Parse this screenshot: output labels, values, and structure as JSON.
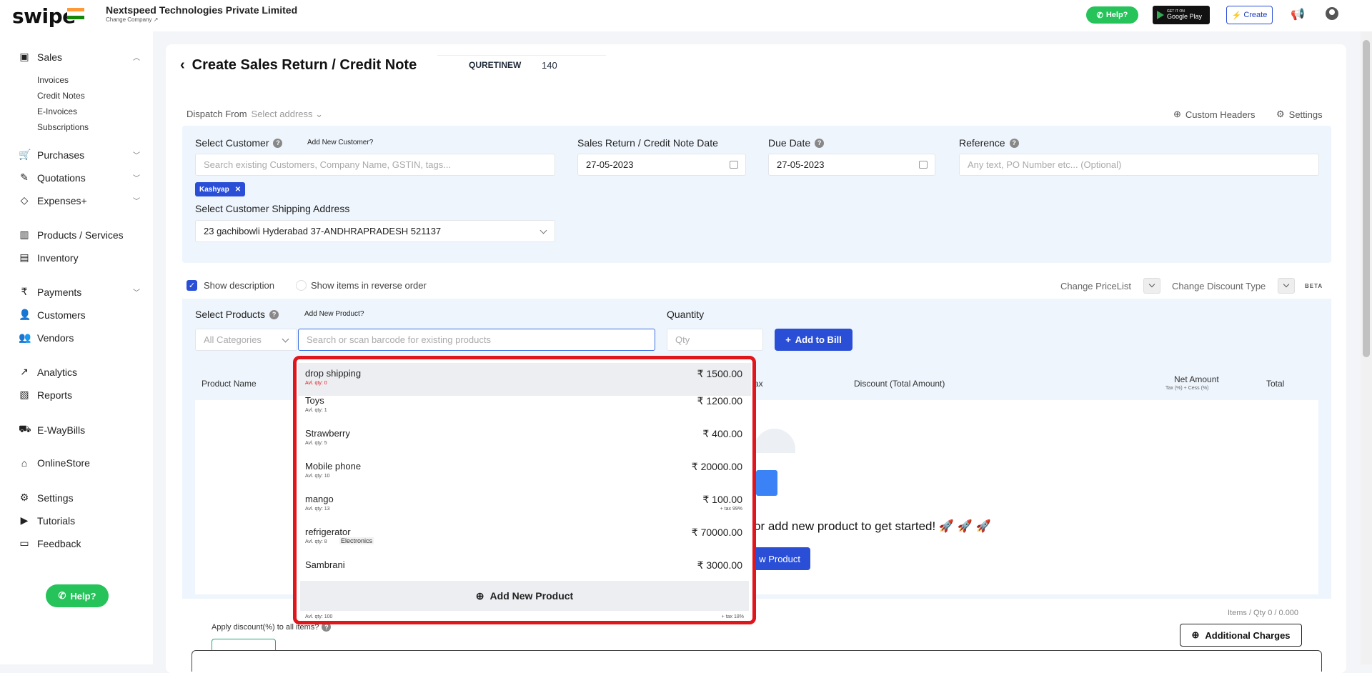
{
  "header": {
    "logo": "swipe",
    "company_name": "Nextspeed Technologies Private Limited",
    "change_company": "Change Company",
    "help_label": "Help?",
    "gplay_small": "GET IT ON",
    "gplay_big": "Google Play",
    "create_label": "Create"
  },
  "sidebar": {
    "sales": "Sales",
    "sales_sub": [
      "Invoices",
      "Credit Notes",
      "E-Invoices",
      "Subscriptions"
    ],
    "purchases": "Purchases",
    "quotations": "Quotations",
    "expenses": "Expenses+",
    "products": "Products / Services",
    "inventory": "Inventory",
    "payments": "Payments",
    "customers": "Customers",
    "vendors": "Vendors",
    "analytics": "Analytics",
    "reports": "Reports",
    "ewaybills": "E-WayBills",
    "onlinestore": "OnlineStore",
    "settings": "Settings",
    "tutorials": "Tutorials",
    "feedback": "Feedback",
    "help": "Help?"
  },
  "page": {
    "title": "Create Sales Return / Credit Note",
    "doc_prefix": "QURETINEW",
    "doc_number": "140",
    "dispatch_label": "Dispatch From",
    "dispatch_value": "Select address",
    "custom_headers": "Custom Headers",
    "settings": "Settings"
  },
  "customer": {
    "label": "Select Customer",
    "add_new": "Add New Customer?",
    "search_placeholder": "Search existing Customers, Company Name, GSTIN, tags...",
    "selected_tag": "Kashyap",
    "shipping_label": "Select Customer Shipping Address",
    "shipping_value": "23 gachibowli Hyderabad 37-ANDHRAPRADESH 521137"
  },
  "dates": {
    "return_label": "Sales Return / Credit Note Date",
    "return_value": "27-05-2023",
    "due_label": "Due Date",
    "due_value": "27-05-2023",
    "reference_label": "Reference",
    "reference_placeholder": "Any text, PO Number etc... (Optional)"
  },
  "options": {
    "show_description": "Show description",
    "show_reverse": "Show items in reverse order",
    "change_pricelist": "Change PriceList",
    "change_discount": "Change Discount Type",
    "beta": "BETA"
  },
  "products": {
    "label": "Select Products",
    "add_new": "Add New Product?",
    "categories_placeholder": "All Categories",
    "search_placeholder": "Search or scan barcode for existing products",
    "quantity_label": "Quantity",
    "qty_placeholder": "Qty",
    "add_to_bill": "Add to Bill"
  },
  "table": {
    "col_product": "Product Name",
    "col_tax_partial": "ax",
    "col_discount": "Discount (Total Amount)",
    "col_net": "Net Amount",
    "col_net_sub": "Tax (%) + Cess (%)",
    "col_total": "Total",
    "empty_message": "or add new product to get started! 🚀 🚀 🚀",
    "new_product_btn": "w Product"
  },
  "dropdown": {
    "items": [
      {
        "name": "drop shipping",
        "qty": "Avl. qty: 0",
        "price": "₹ 1500.00",
        "tax": "",
        "cat": ""
      },
      {
        "name": "Toys",
        "qty": "Avl. qty: 1",
        "price": "₹ 1200.00",
        "tax": "",
        "cat": ""
      },
      {
        "name": "Strawberry",
        "qty": "Avl. qty: 5",
        "price": "₹ 400.00",
        "tax": "",
        "cat": ""
      },
      {
        "name": "Mobile phone",
        "qty": "Avl. qty: 10",
        "price": "₹ 20000.00",
        "tax": "",
        "cat": ""
      },
      {
        "name": "mango",
        "qty": "Avl. qty: 13",
        "price": "₹ 100.00",
        "tax": "+ tax 99%",
        "cat": ""
      },
      {
        "name": "refrigerator",
        "qty": "Avl. qty: 8",
        "price": "₹ 70000.00",
        "tax": "",
        "cat": "Electronics"
      },
      {
        "name": "Sambrani",
        "qty": "",
        "price": "₹ 3000.00",
        "tax": "",
        "cat": ""
      }
    ],
    "add_new": "Add New Product",
    "footer_qty": "Avl. qty: 100",
    "footer_tax": "+ tax 18%"
  },
  "footer": {
    "items_qty": "Items / Qty 0 / 0.000",
    "apply_discount": "Apply discount(%) to all items?",
    "additional_charges": "Additional Charges"
  }
}
